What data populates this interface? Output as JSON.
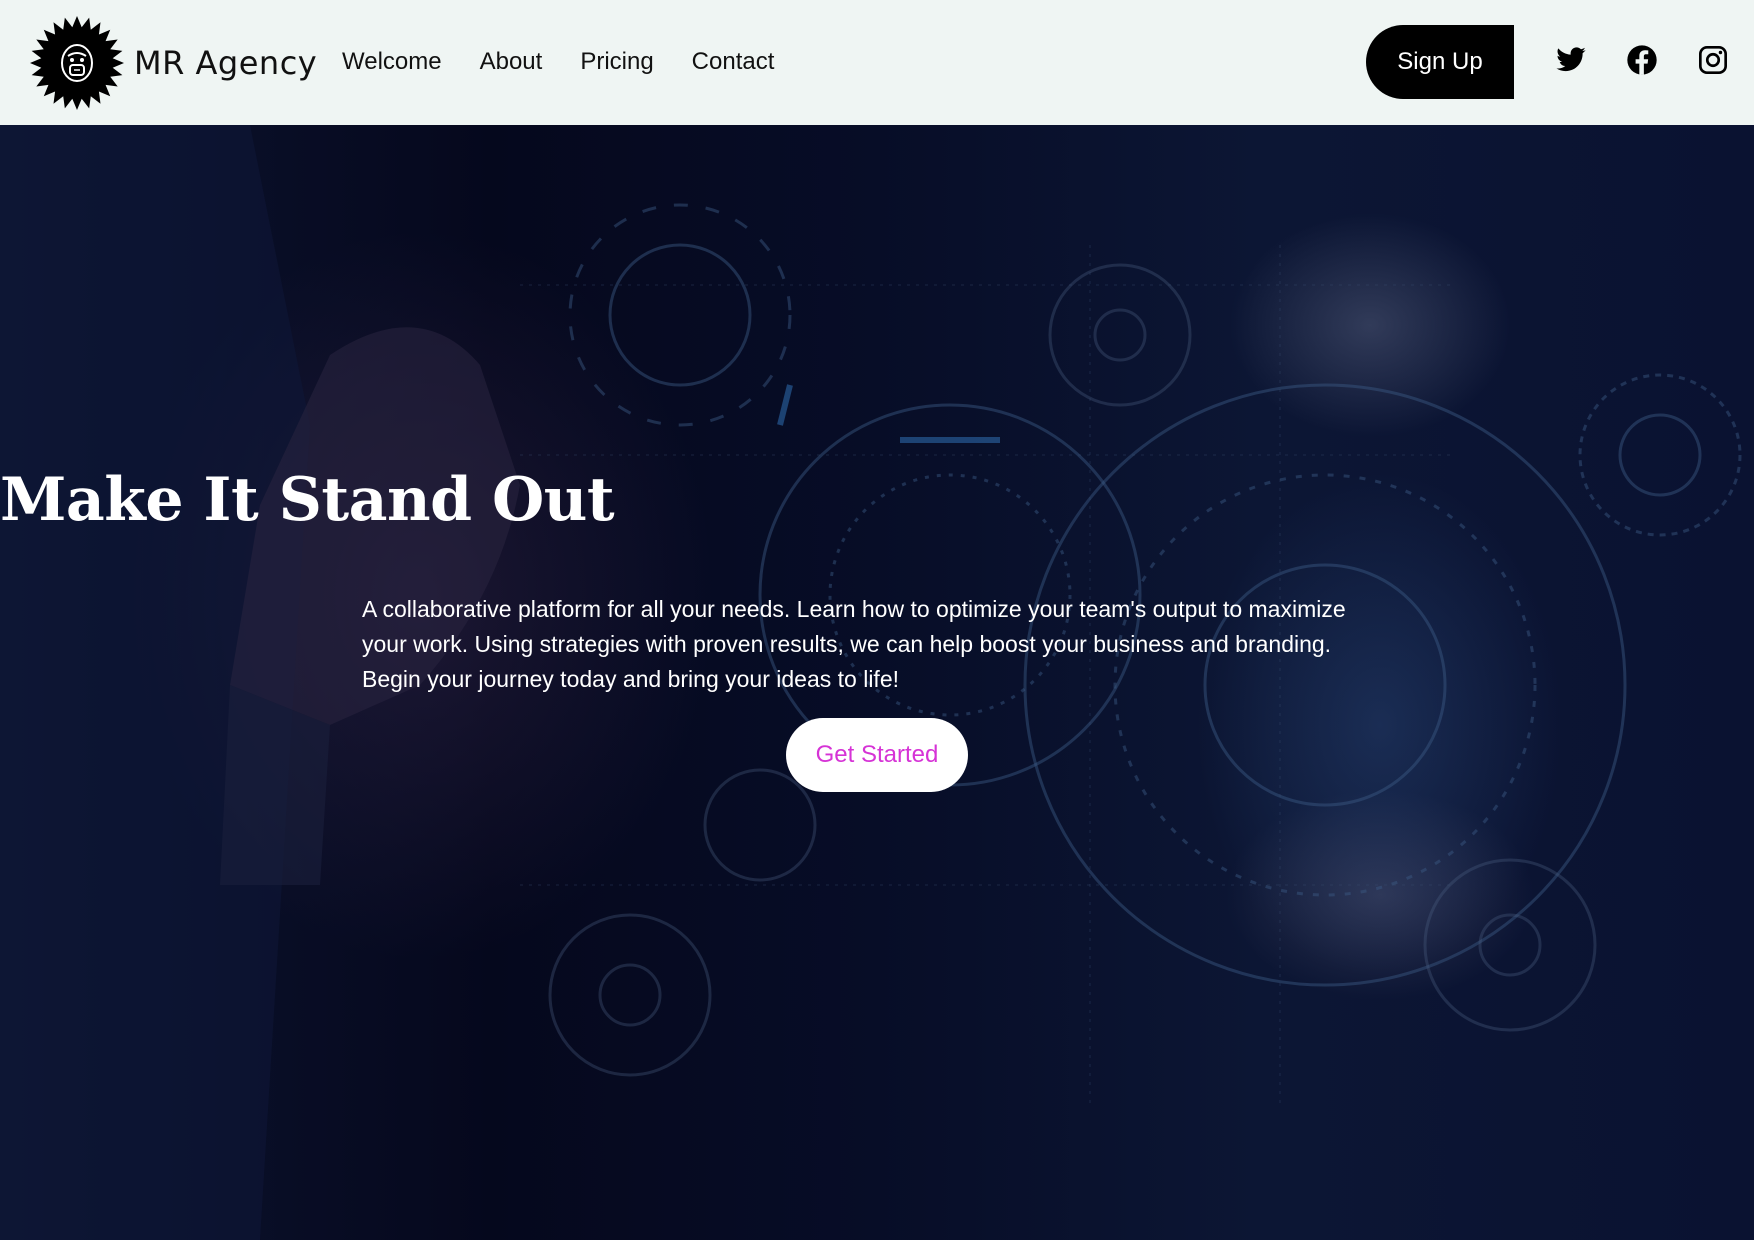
{
  "brand": {
    "name": "MR Agency",
    "logo_icon": "gorilla-badge-icon"
  },
  "nav": {
    "items": [
      {
        "label": "Welcome"
      },
      {
        "label": "About"
      },
      {
        "label": "Pricing"
      },
      {
        "label": "Contact"
      }
    ]
  },
  "header": {
    "signup_label": "Sign Up",
    "social": [
      {
        "icon": "twitter-icon"
      },
      {
        "icon": "facebook-icon"
      },
      {
        "icon": "instagram-icon"
      }
    ]
  },
  "hero": {
    "title": "Make It Stand Out",
    "description": "A collaborative platform for all your needs. Learn how to optimize your team's output to maximize your work. Using strategies with proven results, we can help boost your business and branding. Begin your journey today and bring your ideas to life!",
    "cta_label": "Get Started"
  },
  "colors": {
    "header_bg": "#eff5f3",
    "hero_bg": "#070d27",
    "cta_text": "#d633d6",
    "signup_bg": "#000000"
  }
}
